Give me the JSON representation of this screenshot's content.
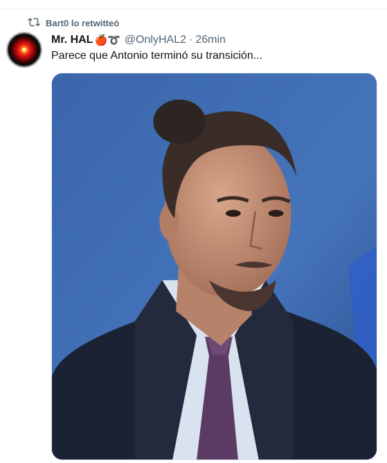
{
  "retweet": {
    "label": "Bart0 lo retwitteó",
    "icon": "retweet-icon"
  },
  "tweet": {
    "display_name": "Mr. HAL",
    "name_emoji": "🍎➰",
    "handle": "@OnlyHAL2",
    "separator": "·",
    "time": "26min",
    "text": "Parece que Antonio terminó su transición...",
    "media": "edited portrait photo of a man in a dark suit and purple tie with a hair bun against a blue background"
  },
  "colors": {
    "text_primary": "#0f1419",
    "text_secondary": "#536471",
    "photo_background": "#3f6eb0"
  }
}
